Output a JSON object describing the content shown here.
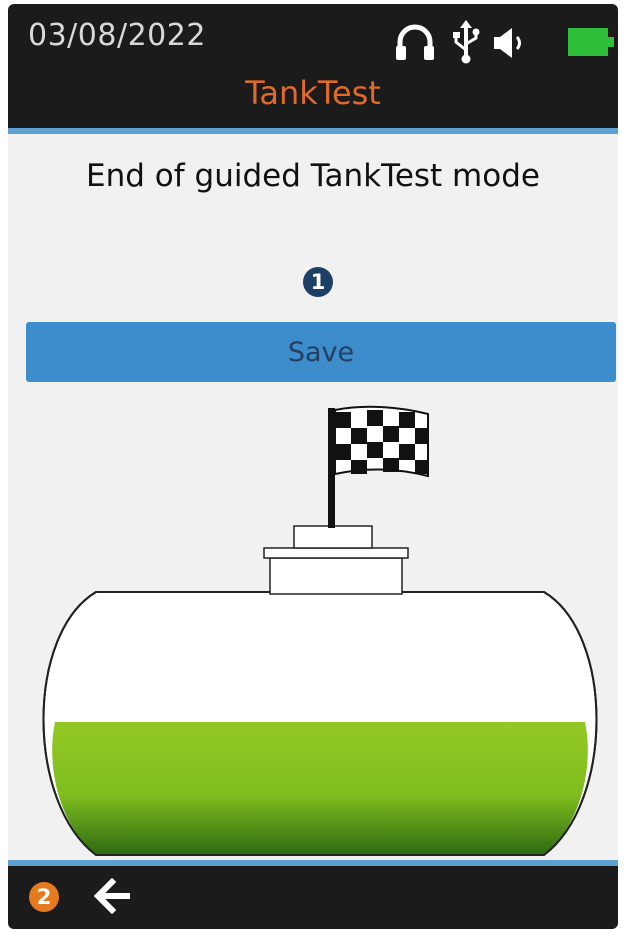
{
  "status_bar": {
    "date": "03/08/2022",
    "icons": [
      "headphones-icon",
      "usb-icon",
      "speaker-icon",
      "battery-icon"
    ],
    "battery_color": "#2fbf3a"
  },
  "header": {
    "title": "TankTest",
    "title_color": "#e06a2a"
  },
  "main": {
    "heading": "End of guided TankTest mode",
    "marker_1": "1",
    "save_label": "Save",
    "tank": {
      "fill_color": "#7fbd1e",
      "fill_level": 0.38,
      "flag": "checkered-flag-icon"
    }
  },
  "bottom_bar": {
    "marker_2": "2",
    "back_icon": "back-arrow-icon"
  },
  "colors": {
    "accent_blue": "#3d8ccc",
    "rule_blue": "#5da0d1",
    "marker_dark": "#1d3f66",
    "marker_orange": "#e67a1e"
  }
}
